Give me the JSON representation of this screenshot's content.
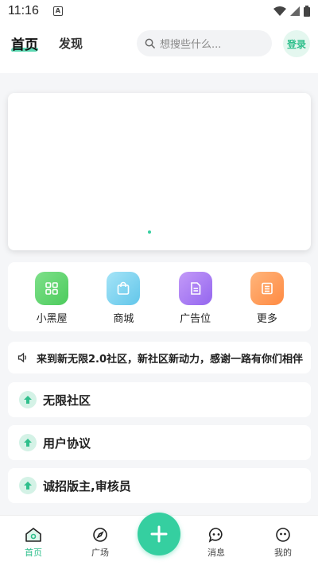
{
  "status_bar": {
    "time": "11:16",
    "notification_icon": "A"
  },
  "header": {
    "tabs": [
      {
        "label": "首页",
        "active": true
      },
      {
        "label": "发现",
        "active": false
      }
    ],
    "search": {
      "placeholder": "想搜些什么..."
    },
    "login_label": "登录"
  },
  "banner": {
    "page_count": 1,
    "active_page": 1
  },
  "quick_grid": {
    "items": [
      {
        "label": "小黑屋",
        "icon": "grid-icon",
        "color": "#5fd46a"
      },
      {
        "label": "商城",
        "icon": "shopping-bag-icon",
        "color": "#7fd3ef"
      },
      {
        "label": "广告位",
        "icon": "document-icon",
        "color": "#a77cf2"
      },
      {
        "label": "更多",
        "icon": "list-icon",
        "color": "#ff9a55"
      }
    ]
  },
  "notice": {
    "icon": "speaker-icon",
    "text": "来到新无限2.0社区，新社区新动力，感谢一路有你们相伴"
  },
  "list": {
    "items": [
      {
        "label": "无限社区",
        "icon": "up-arrow-icon"
      },
      {
        "label": "用户协议",
        "icon": "up-arrow-icon"
      },
      {
        "label": "诚招版主,审核员",
        "icon": "up-arrow-icon"
      }
    ]
  },
  "bottom_nav": {
    "items": [
      {
        "label": "首页",
        "icon": "home-icon",
        "active": true
      },
      {
        "label": "广场",
        "icon": "compass-icon",
        "active": false
      },
      {
        "label": "消息",
        "icon": "chat-icon",
        "active": false
      },
      {
        "label": "我的",
        "icon": "profile-icon",
        "active": false
      }
    ],
    "fab_icon": "plus-icon"
  },
  "colors": {
    "accent": "#35cfa0",
    "background": "#f5f6f8"
  }
}
